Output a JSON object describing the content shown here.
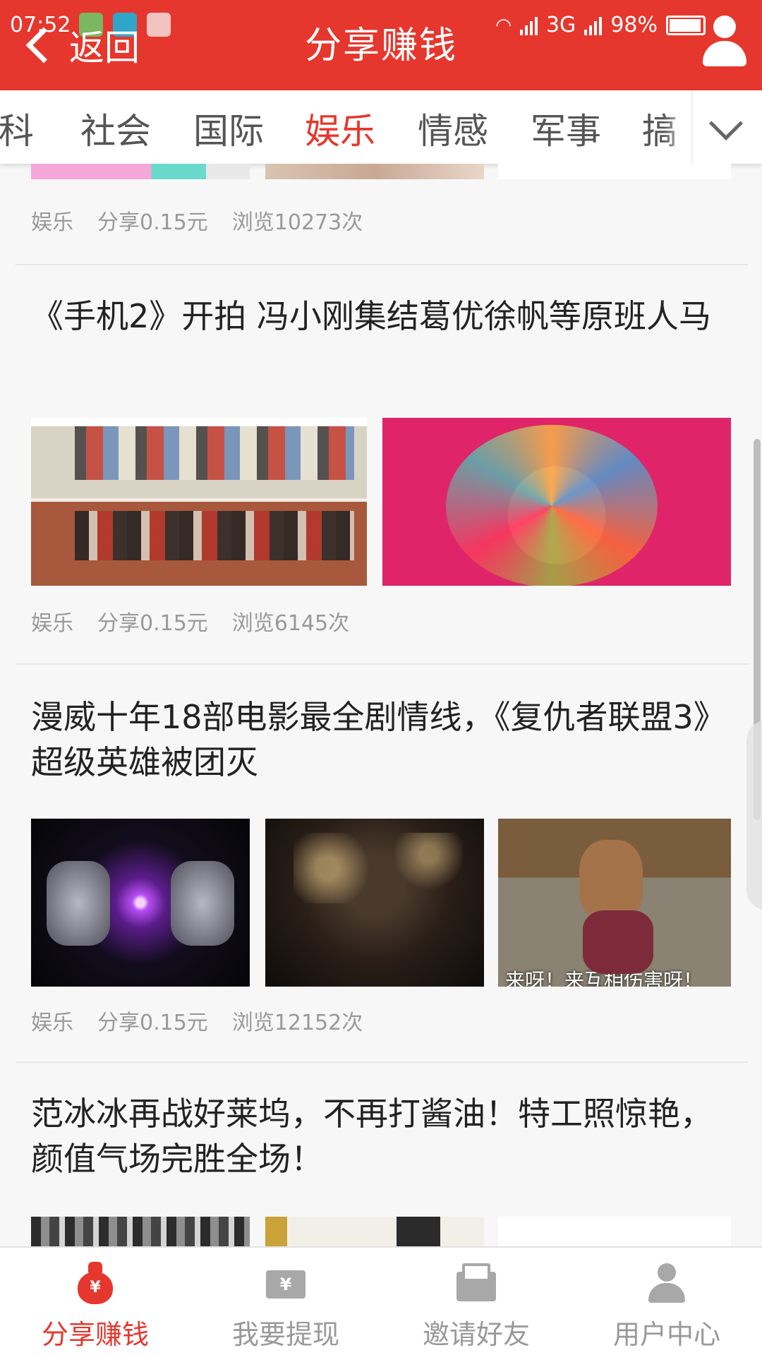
{
  "status_bar": {
    "time": "07:52",
    "network": "3G",
    "battery": "98%"
  },
  "header": {
    "back_label": "返回",
    "title": "分享赚钱"
  },
  "tabs": [
    {
      "label": "科",
      "active": false
    },
    {
      "label": "社会",
      "active": false
    },
    {
      "label": "国际",
      "active": false
    },
    {
      "label": "娱乐",
      "active": true
    },
    {
      "label": "情感",
      "active": false
    },
    {
      "label": "军事",
      "active": false
    },
    {
      "label": "搞",
      "active": false
    }
  ],
  "feed": {
    "partial_item": {
      "category": "娱乐",
      "share": "分享0.15元",
      "views": "浏览10273次"
    },
    "articles": [
      {
        "title": "《手机2》开拍 冯小刚集结葛优徐帆等原班人马",
        "category": "娱乐",
        "share": "分享0.15元",
        "views": "浏览6145次"
      },
      {
        "title": "漫威十年18部电影最全剧情线，《复仇者联盟3》超级英雄被团灭",
        "category": "娱乐",
        "share": "分享0.15元",
        "views": "浏览12152次",
        "image_caption": "来呀！来互相伤害呀！"
      },
      {
        "title": "范冰冰再战好莱坞，不再打酱油！特工照惊艳，颜值气场完胜全场！"
      }
    ]
  },
  "bottom_nav": [
    {
      "label": "分享赚钱",
      "icon": "money-bag-icon",
      "active": true
    },
    {
      "label": "我要提现",
      "icon": "cash-ticket-icon",
      "active": false
    },
    {
      "label": "邀请好友",
      "icon": "envelope-icon",
      "active": false
    },
    {
      "label": "用户中心",
      "icon": "user-icon",
      "active": false
    }
  ],
  "colors": {
    "brand": "#e5372d",
    "inactive": "#999999",
    "background": "#f7f7f7"
  }
}
